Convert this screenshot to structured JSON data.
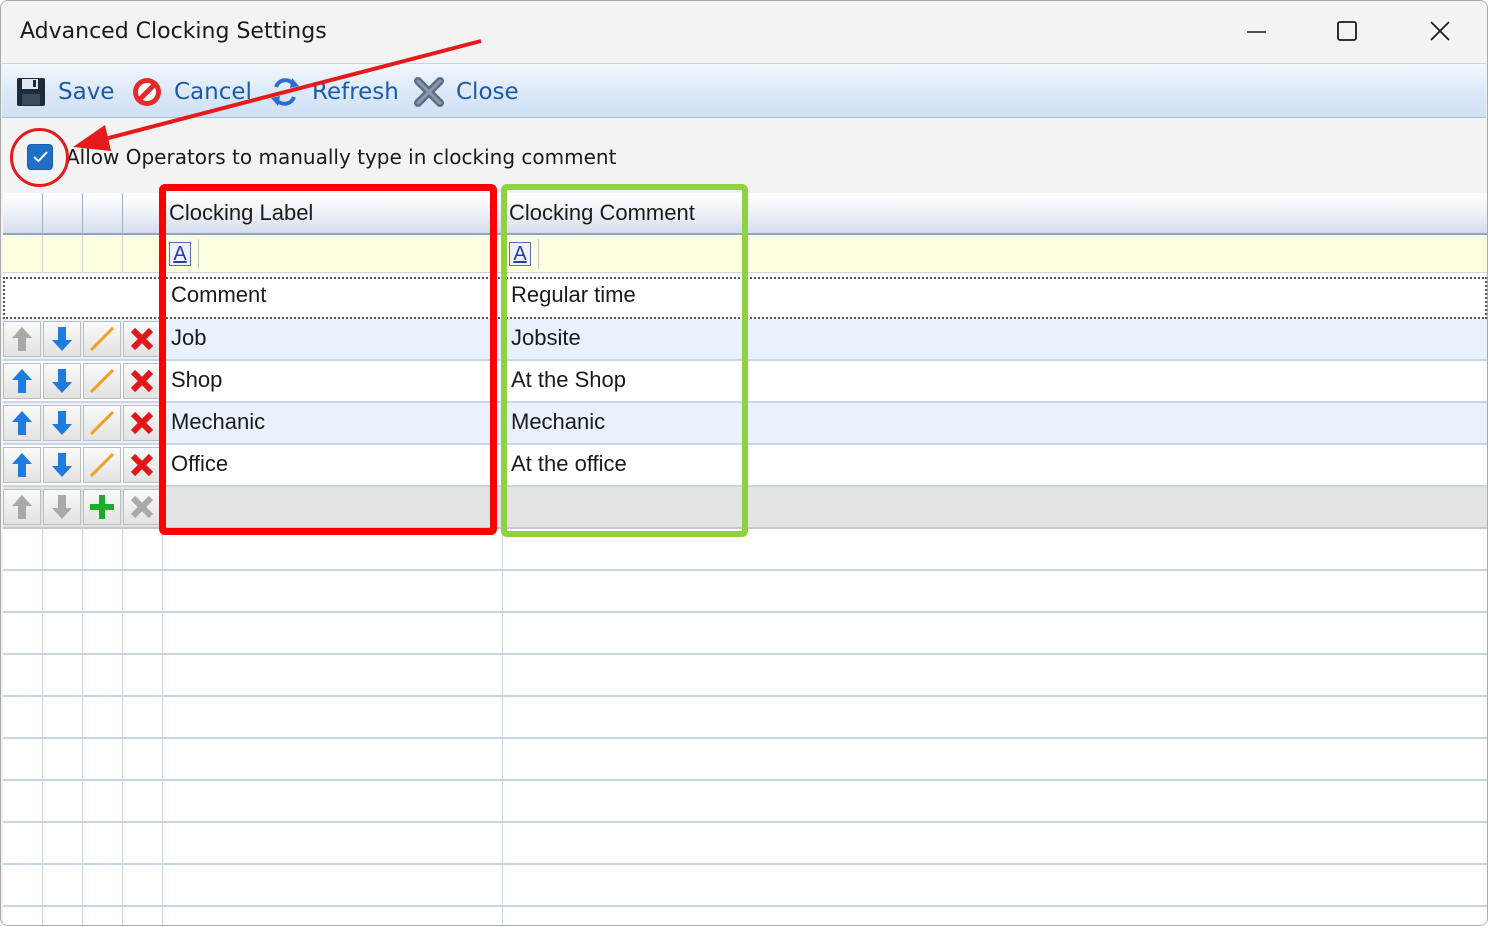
{
  "window": {
    "title": "Advanced Clocking Settings",
    "controls": [
      "minimize",
      "maximize",
      "close"
    ]
  },
  "toolbar": {
    "save_label": "Save",
    "cancel_label": "Cancel",
    "refresh_label": "Refresh",
    "close_label": "Close"
  },
  "options": {
    "allow_manual_comment_label": "Allow Operators to manually type in clocking comment",
    "allow_manual_comment_checked": true
  },
  "grid": {
    "columns": [
      "Clocking Label",
      "Clocking Comment"
    ],
    "filter_icon_glyph": "A",
    "template_row": {
      "label": "Comment",
      "comment": "Regular time"
    },
    "rows": [
      {
        "label": "Job",
        "comment": "Jobsite"
      },
      {
        "label": "Shop",
        "comment": "At the Shop"
      },
      {
        "label": "Mechanic",
        "comment": "Mechanic"
      },
      {
        "label": "Office",
        "comment": "At the office"
      }
    ]
  },
  "colors": {
    "toolbar_text": "#1c5aa8",
    "annotation_red": "#ff0000",
    "annotation_green": "#8fd13f",
    "checkbox_blue": "#1f6fc8"
  }
}
